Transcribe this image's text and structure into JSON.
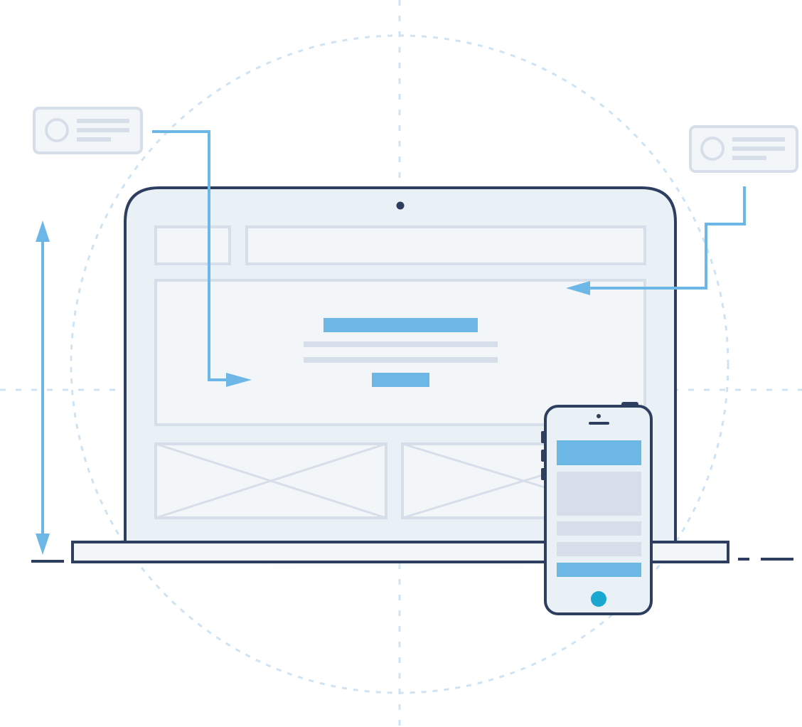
{
  "colors": {
    "outline": "#2d3e5e",
    "accent_blue": "#6db7e6",
    "guide_dashed": "#cfe3f3",
    "wire_gray": "#d6dfe9",
    "screen_fill": "#e9f0f6",
    "panel_fill": "#f3f6f9",
    "phone_button": "#1ba8d0",
    "background": "#ffffff"
  },
  "icons": {
    "left_callout": "profile-card-icon",
    "right_callout": "profile-card-icon",
    "laptop_camera": "camera-dot-icon",
    "phone_home": "home-button-icon",
    "height_arrow": "double-headed-arrow-icon",
    "image_placeholder": "image-placeholder-icon"
  }
}
